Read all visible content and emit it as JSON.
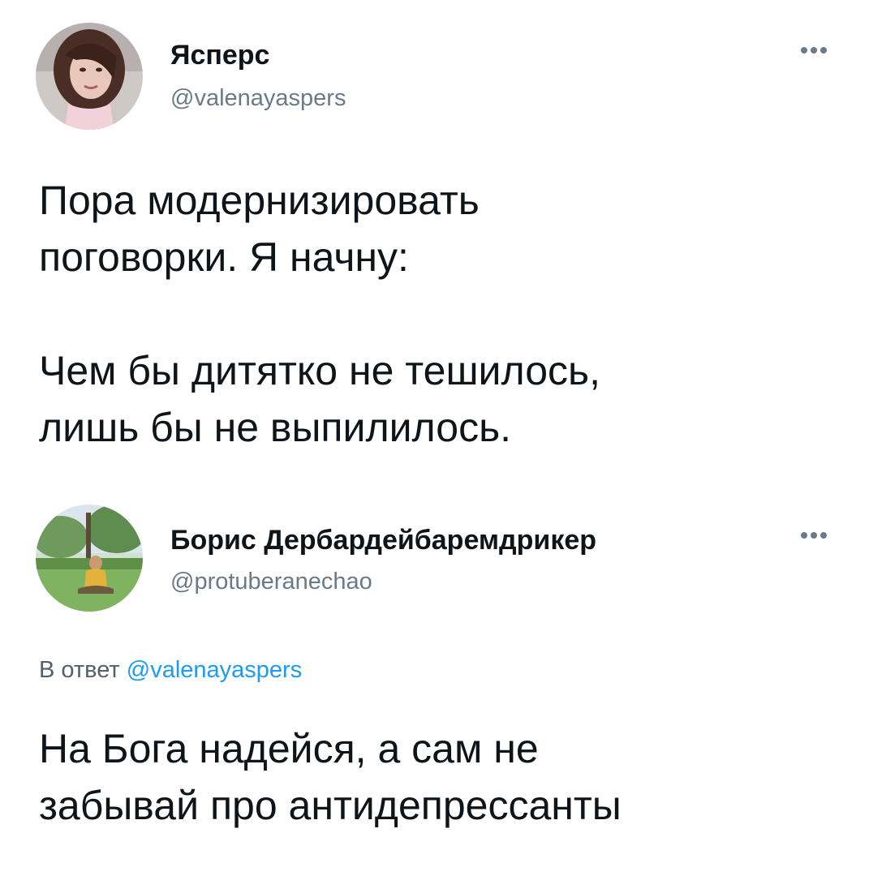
{
  "tweets": [
    {
      "author_name": "Ясперс",
      "author_handle": "@valenayaspers",
      "more_icon": "more-horizontal-icon",
      "text": "Пора модернизировать\nпоговорки. Я начну:\n\nЧем бы дитятко не тешилось,\nлишь бы не выпилилось."
    },
    {
      "author_name": "Борис Дербардейбаремдрикер",
      "author_handle": "@protuberanechao",
      "more_icon": "more-horizontal-icon",
      "reply_prefix": "В ответ",
      "reply_mention": "@valenayaspers",
      "text": "На Бога надейся, а сам не\nзабывай про антидепрессанты"
    }
  ],
  "colors": {
    "text": "#0f1419",
    "secondary": "#6b7a88",
    "link": "#1d9bf0",
    "background": "#ffffff"
  }
}
